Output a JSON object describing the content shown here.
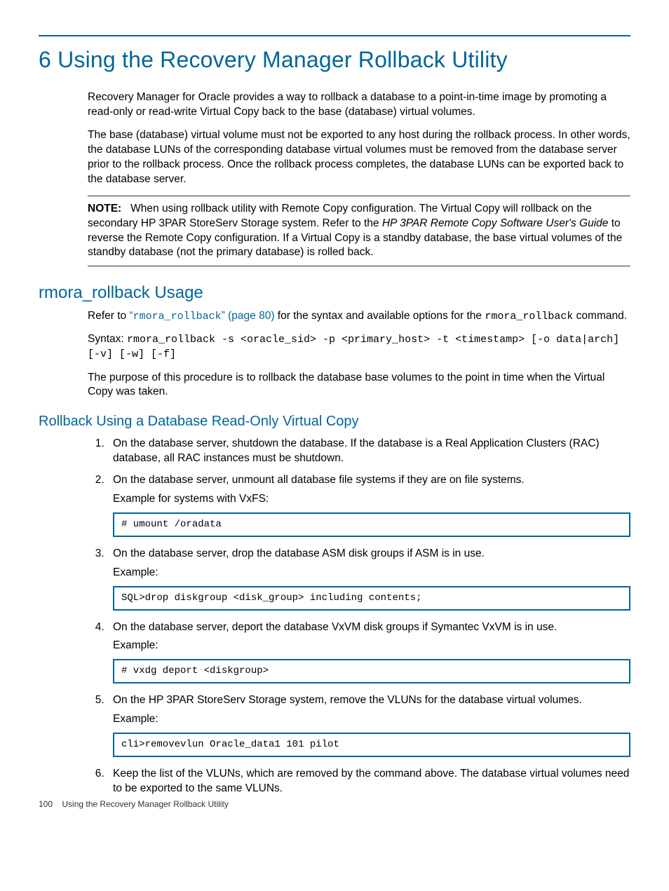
{
  "chapter": {
    "number": "6",
    "title": "Using the Recovery Manager Rollback Utility"
  },
  "intro": {
    "p1": "Recovery Manager for Oracle provides a way to rollback a database to a point-in-time image by promoting a read-only or read-write Virtual Copy back to the base (database) virtual volumes.",
    "p2": "The base (database) virtual volume must not be exported to any host during the rollback process. In other words, the database LUNs of the corresponding database virtual volumes must be removed from the database server prior to the rollback process. Once the rollback process completes, the database LUNs can be exported back to the database server."
  },
  "note": {
    "label": "NOTE:",
    "text_before_italic": "When using rollback utility with Remote Copy configuration. The Virtual Copy will rollback on the secondary HP 3PAR StoreServ Storage system. Refer to the ",
    "italic": "HP 3PAR Remote Copy Software User's Guide",
    "text_after_italic": " to reverse the Remote Copy configuration. If a Virtual Copy is a standby database, the base virtual volumes of the standby database (not the primary database) is rolled back."
  },
  "usage": {
    "heading": "rmora_rollback Usage",
    "refer_prefix": "Refer to ",
    "xref_quote_open": "“",
    "xref_cmd": "rmora_rollback",
    "xref_quote_close": "” (page 80)",
    "refer_suffix": " for the syntax and available options for the ",
    "refer_cmd2": "rmora_rollback",
    "refer_tail": " command.",
    "syntax_label": "Syntax: ",
    "syntax_code": "rmora_rollback -s <oracle_sid> -p <primary_host> -t <timestamp> [-o data|arch] [-v] [-w] [-f]",
    "purpose": "The purpose of this procedure is to rollback the database base volumes to the point in time when the Virtual Copy was taken."
  },
  "rollback_ro": {
    "heading": "Rollback Using a Database Read-Only Virtual Copy",
    "steps": {
      "s1": "On the database server, shutdown the database. If the database is a Real Application Clusters (RAC) database, all RAC instances must be shutdown.",
      "s2": "On the database server, unmount all database file systems if they are on file systems.",
      "s2_example_label": "Example for systems with VxFS:",
      "s2_code": "# umount /oradata",
      "s3": "On the database server, drop the database ASM disk groups if ASM is in use.",
      "s3_example_label": "Example:",
      "s3_code": "SQL>drop diskgroup <disk_group> including contents;",
      "s4": "On the database server, deport the database VxVM disk groups if Symantec VxVM is in use.",
      "s4_example_label": "Example:",
      "s4_code": "# vxdg deport <diskgroup>",
      "s5": "On the HP 3PAR StoreServ Storage system, remove the VLUNs for the database virtual volumes.",
      "s5_example_label": "Example:",
      "s5_code": "cli>removevlun Oracle_data1 101 pilot",
      "s6": "Keep the list of the VLUNs, which are removed by the command above. The database virtual volumes need to be exported to the same VLUNs."
    }
  },
  "footer": {
    "page_number": "100",
    "title": "Using the Recovery Manager Rollback Utility"
  }
}
